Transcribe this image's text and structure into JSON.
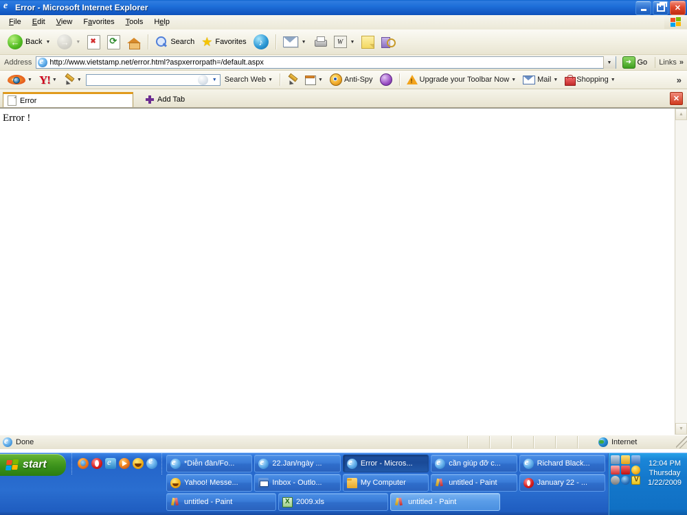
{
  "window": {
    "title": "Error - Microsoft Internet Explorer",
    "icon": "ie-icon",
    "minimize_label": "Minimize",
    "maximize_label": "Restore",
    "close_label": "Close"
  },
  "menubar": {
    "items": [
      {
        "label": "File",
        "accel": "F",
        "rest": "ile"
      },
      {
        "label": "Edit",
        "accel": "E",
        "rest": "dit"
      },
      {
        "label": "View",
        "accel": "V",
        "rest": "iew"
      },
      {
        "label": "Favorites",
        "pre": "F",
        "accel": "a",
        "rest": "vorites"
      },
      {
        "label": "Tools",
        "accel": "T",
        "rest": "ools"
      },
      {
        "label": "Help",
        "pre": "H",
        "accel": "e",
        "rest": "lp"
      }
    ],
    "logo": "windows-flag-icon"
  },
  "toolbar": {
    "back_label": "Back",
    "forward_label": "",
    "stop_label": "",
    "refresh_label": "",
    "home_label": "",
    "search_label": "Search",
    "favorites_label": "Favorites",
    "media_label": "",
    "mail_label": "",
    "print_label": "",
    "edit_label": "W",
    "notes_label": "",
    "research_label": ""
  },
  "address": {
    "label": "Address",
    "url": "http://www.vietstamp.net/error.html?aspxerrorpath=/default.aspx",
    "go_label": "Go",
    "links_label": "Links",
    "overflow": "»"
  },
  "yahoo_toolbar": {
    "search_value": "",
    "search_web_label": "Search Web",
    "antispy_label": "Anti-Spy",
    "upgrade_label": "Upgrade your Toolbar Now",
    "mail_label": "Mail",
    "shopping_label": "Shopping",
    "overflow": "»"
  },
  "tabbar": {
    "tabs": [
      {
        "label": "Error"
      }
    ],
    "add_tab_label": "Add Tab",
    "close_label": "✕"
  },
  "page": {
    "body_text": "Error !"
  },
  "statusbar": {
    "status_text": "Done",
    "zone_text": "Internet"
  },
  "taskbar": {
    "start_label": "start",
    "quick_launch": [
      {
        "name": "firefox-icon"
      },
      {
        "name": "opera-icon"
      },
      {
        "name": "app-icon"
      },
      {
        "name": "media-player-icon"
      },
      {
        "name": "yahoo-messenger-icon"
      },
      {
        "name": "internet-explorer-icon"
      }
    ],
    "rows": [
      [
        {
          "label": "*Diễn đàn/Fo...",
          "icon": "ie-icon",
          "state": "normal"
        },
        {
          "label": "22.Jan/ngày ...",
          "icon": "ie-icon",
          "state": "normal"
        },
        {
          "label": "Error - Micros...",
          "icon": "ie-icon",
          "state": "active"
        },
        {
          "label": "cần giúp đỡ c...",
          "icon": "ie-icon",
          "state": "normal"
        },
        {
          "label": "Richard Black...",
          "icon": "ie-icon",
          "state": "normal"
        }
      ],
      [
        {
          "label": "Yahoo! Messe...",
          "icon": "yahoo-messenger-icon",
          "state": "normal"
        },
        {
          "label": "Inbox - Outlo...",
          "icon": "outlook-icon",
          "state": "normal"
        },
        {
          "label": "My Computer",
          "icon": "folder-icon",
          "state": "normal"
        },
        {
          "label": "untitled - Paint",
          "icon": "paint-icon",
          "state": "normal"
        },
        {
          "label": "January 22 - ...",
          "icon": "opera-icon",
          "state": "normal"
        }
      ],
      [
        {
          "label": "untitled - Paint",
          "icon": "paint-icon",
          "state": "normal"
        },
        {
          "label": "2009.xls",
          "icon": "excel-icon",
          "state": "normal"
        },
        {
          "label": "untitled - Paint",
          "icon": "paint-icon",
          "state": "hover"
        }
      ]
    ],
    "tray": {
      "icons": [
        "network-icon",
        "mail-icon",
        "display-icon",
        "users-icon",
        "health-icon",
        "messenger-icon",
        "volume-icon",
        "update-icon"
      ],
      "v_icon": "vietkey-icon",
      "time": "12:04 PM",
      "day": "Thursday",
      "date": "1/22/2009"
    }
  },
  "colors": {
    "title_blue": "#1257c2",
    "taskbar_blue": "#2464c9",
    "start_green": "#4a9e22",
    "chrome_beige": "#ece9d8",
    "tab_orange": "#e09a1c"
  }
}
